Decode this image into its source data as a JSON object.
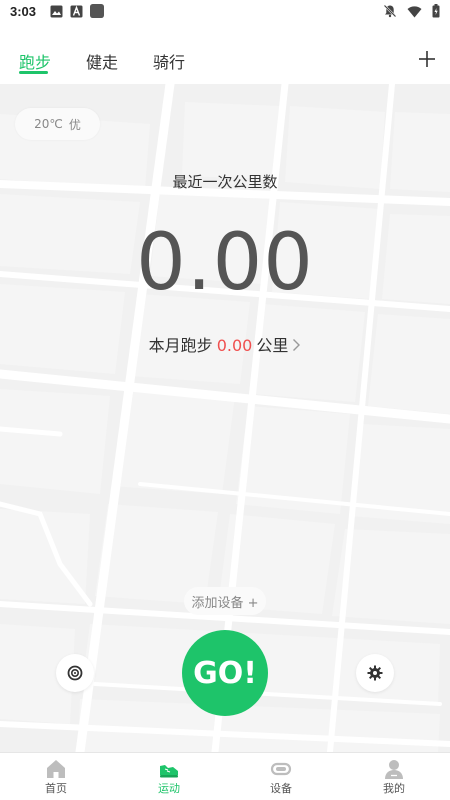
{
  "status_bar": {
    "time": "3:03",
    "left_icons": [
      "image-icon",
      "font-icon",
      "app-square-icon"
    ],
    "right_icons": [
      "notifications-off-icon",
      "wifi-icon",
      "battery-icon"
    ]
  },
  "tabs": [
    {
      "label": "跑步",
      "active": true
    },
    {
      "label": "健走",
      "active": false
    },
    {
      "label": "骑行",
      "active": false
    }
  ],
  "add_icon": "plus-icon",
  "weather": {
    "temp": "20℃",
    "quality": "优"
  },
  "recent": {
    "label": "最近一次公里数",
    "value": "0.00"
  },
  "month": {
    "prefix": "本月跑步",
    "value": "0.00",
    "unit": "公里"
  },
  "add_device": "添加设备 +",
  "go_label": "GO!",
  "accent_color": "#1ec46a",
  "highlight_color": "#f0504f",
  "bottom_nav": [
    {
      "label": "首页",
      "icon": "home-icon",
      "active": false
    },
    {
      "label": "运动",
      "icon": "sneaker-icon",
      "active": true
    },
    {
      "label": "设备",
      "icon": "band-icon",
      "active": false
    },
    {
      "label": "我的",
      "icon": "user-icon",
      "active": false
    }
  ]
}
